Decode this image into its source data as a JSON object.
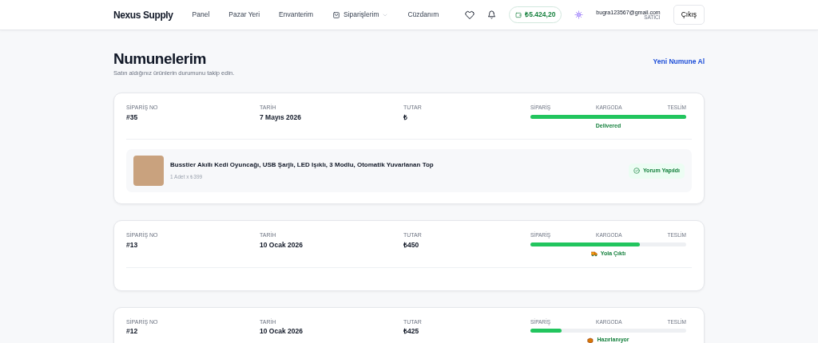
{
  "navbar": {
    "brand": "Nexus Supply",
    "links": [
      {
        "label": "Panel",
        "kind": "plain"
      },
      {
        "label": "Pazar Yeri",
        "kind": "plain"
      },
      {
        "label": "Envanterim",
        "kind": "plain"
      },
      {
        "label": "Siparişlerim",
        "kind": "dropdown"
      },
      {
        "label": "Cüzdanım",
        "kind": "plain"
      }
    ],
    "balance": "₺5.424,20",
    "user": {
      "email": "bugra123567@gmail.com",
      "role": "SATICI"
    },
    "logout": "Çıkış"
  },
  "page": {
    "title": "Numunelerim",
    "subtitle": "Satın aldığınız ürünlerin durumunu takip edin.",
    "action": "Yeni Numune Al"
  },
  "orders": [
    {
      "labels": [
        "SİPARİŞ NO",
        "TARİH",
        "TUTAR"
      ],
      "order_no": "#35",
      "date": "7 Mayıs 2026",
      "amount": "₺",
      "steps": [
        "SİPARİŞ",
        "KARGODA",
        "TESLİM"
      ],
      "level": 1.0,
      "status": {
        "kind": "delivered",
        "label": "Delivered"
      },
      "items": [
        {
          "name": "Busstier Akıllı Kedi Oyuncağı, USB Şarjlı, LED Işıklı, 3 Modlu, Otomatik Yuvarlanan Top",
          "detail": "1 Adet x ₺399",
          "review": "Yorum Yapıldı"
        }
      ]
    },
    {
      "labels": [
        "SİPARİŞ NO",
        "TARİH",
        "TUTAR"
      ],
      "order_no": "#13",
      "date": "10 Ocak 2026",
      "amount": "₺450",
      "steps": [
        "SİPARİŞ",
        "KARGODA",
        "TESLİM"
      ],
      "level": 0.7,
      "status": {
        "kind": "shipped",
        "label": "Yola Çıktı"
      }
    },
    {
      "labels": [
        "SİPARİŞ NO",
        "TARİH",
        "TUTAR"
      ],
      "order_no": "#12",
      "date": "10 Ocak 2026",
      "amount": "₺425",
      "steps": [
        "SİPARİŞ",
        "KARGODA",
        "TESLİM"
      ],
      "level": 0.2,
      "status": {
        "kind": "preparing",
        "label": "Hazırlanıyor"
      }
    }
  ]
}
